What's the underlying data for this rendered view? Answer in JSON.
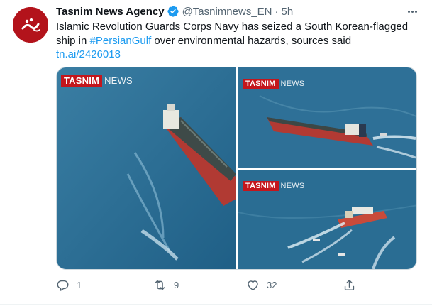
{
  "author": {
    "name": "Tasnim News Agency",
    "handle": "@Tasnimnews_EN",
    "separator": "·",
    "time": "5h",
    "verified": true
  },
  "tweet": {
    "text_before_hashtag": "Islamic Revolution Guards Corps Navy has seized a South Korean-flagged ship in ",
    "hashtag": "#PersianGulf",
    "text_after_hashtag": " over environmental hazards, sources said",
    "link": "tn.ai/2426018"
  },
  "media": {
    "watermark_brand": "TASNIM",
    "watermark_suffix": "NEWS"
  },
  "actions": {
    "reply_count": "1",
    "retweet_count": "9",
    "like_count": "32"
  },
  "colors": {
    "accent": "#1d9bf0",
    "secondary_text": "#536471",
    "brand_red": "#c4161c",
    "sea": "#2c6f93"
  },
  "icons": {
    "verified": "verified-badge-icon",
    "more": "more-icon",
    "reply": "reply-icon",
    "retweet": "retweet-icon",
    "like": "heart-icon",
    "share": "share-icon"
  }
}
